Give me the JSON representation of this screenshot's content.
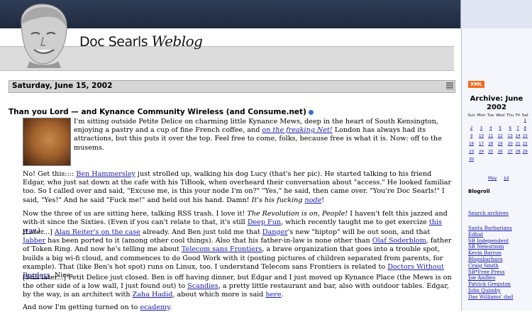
{
  "blog": {
    "title_main": "Doc Searls",
    "title_sub": "Weblog"
  },
  "date_header": "Saturday, June 15, 2002",
  "post": {
    "title": "Than you Lord — and Kynance Community Wireless (and Consume.net)",
    "p1": {
      "t1": "I'm sitting outside Petite Delice on charming little Kynance Mews, deep in the heart of South Kensington, enjoying a pastry and a cup of fine French coffee, and ",
      "link": "on the freaking Net!",
      "t2": " London has always had its attractions, but this puts it over the top. Feel free to come, folks, because free is what it is. Now: off to the musems."
    },
    "p2": {
      "t1": "No! Get this:::: ",
      "link1": "Ben Hammersley",
      "t2": " just strolled up, walking his dog Lucy (that's her pic). He started talking to his friend Edgar, who just sat down at the cafe with his TiBook, when overheard their conversation about \"access.\" He looked familiar too. So I called over and said, \"Excuse me, is this your node I'm on?\" \"Yes,\" he said, then came over. \"You're Doc Searls!\" I said, \"Yes!\" And he said \"Fuck me!\" and held out his hand. Damn! ",
      "ital": "It's his fucking ",
      "link2": "node",
      "t3": "!"
    },
    "p3": {
      "t1": "Now the three of us are sitting here, talking RSS trash. I love it! ",
      "ital": "The Revolution is on, People!",
      "t2": " I haven't felt this jazzed and with-it since the Sixties. (Even if you can't relate to that, it's still ",
      "link1": "Deep Fun",
      "t3": ", which recently taught me to get exercize ",
      "link2": "this way",
      "t4": ".)"
    },
    "p4": {
      "t1": "[Later...] ",
      "link1": "Alan Reiter's on the case",
      "t2": " already. And Ben just told me that ",
      "link2": "Danger",
      "t3": "'s new \"hiptop\" will be out soon, and that ",
      "link3": "Jabber",
      "t4": " has been ported to it (among other cool things). Also that his father-in-law is none other than ",
      "link4": "Olaf Soderblom",
      "t5": ", father of Token Ring. And now he's telling me about ",
      "link5": "Telecom sans Frontiers",
      "t6": ", a brave organization that goes into a trouble spot, builds a big wi-fi cloud, and commences to do Good Work with it (posting pictures of children separated from parents, for example). That (like Ben's hot spot) runs on Linux, too. I understand Telecom sans Frontiers is related to ",
      "link6": "Doctors Without Borders",
      "t7": ". Nice."
    },
    "p5": {
      "t1": "[Still later...] Petit Delice just closed. Ben is off having dinner, but Edgar and I just moved up Kynance Place (the Mews is on the other side of a low wall, I just found out) to ",
      "link1": "Scandies",
      "t2": ", a pretty little restaurant and bar, also with outdoor tables. Edgar, by the way, is an architect with ",
      "link2": "Zaha Hadid",
      "t3": ", about which more is said ",
      "link3": "here",
      "t4": "."
    },
    "p6": {
      "t1": "And now I'm getting turned on to ",
      "link": "ecademy",
      "t2": "."
    }
  },
  "sidebar": {
    "xml_badge": "XML",
    "archive_title": "Archive: June 2002",
    "cal_headers": [
      "Sun",
      "Mon",
      "Tue",
      "Wed",
      "Thu",
      "Fri",
      "Sat"
    ],
    "cal_weeks": [
      [
        "",
        "",
        "",
        "",
        "",
        "",
        "1"
      ],
      [
        "2",
        "3",
        "4",
        "5",
        "6",
        "7",
        "8"
      ],
      [
        "9",
        "10",
        "11",
        "12",
        "13",
        "14",
        "15"
      ],
      [
        "16",
        "17",
        "18",
        "19",
        "20",
        "21",
        "22"
      ],
      [
        "23",
        "24",
        "25",
        "26",
        "27",
        "28",
        "29"
      ],
      [
        "30",
        "",
        "",
        "",
        "",
        "",
        ""
      ]
    ],
    "prev_month": "May",
    "next_month": "Jul",
    "blogroll_heading": "Blogroll",
    "search_link": "Search archives",
    "blogroll": [
      "Santa Barbarians",
      "Edhat",
      "SB Independent",
      "SB Newsroom",
      "Kevin Barron",
      "Blogabarbara",
      "Craig Smith",
      "SB*Free Press",
      "Joe Andieu",
      "Patrick Gregston",
      "John Quimby",
      "Das Williams' dad"
    ]
  }
}
